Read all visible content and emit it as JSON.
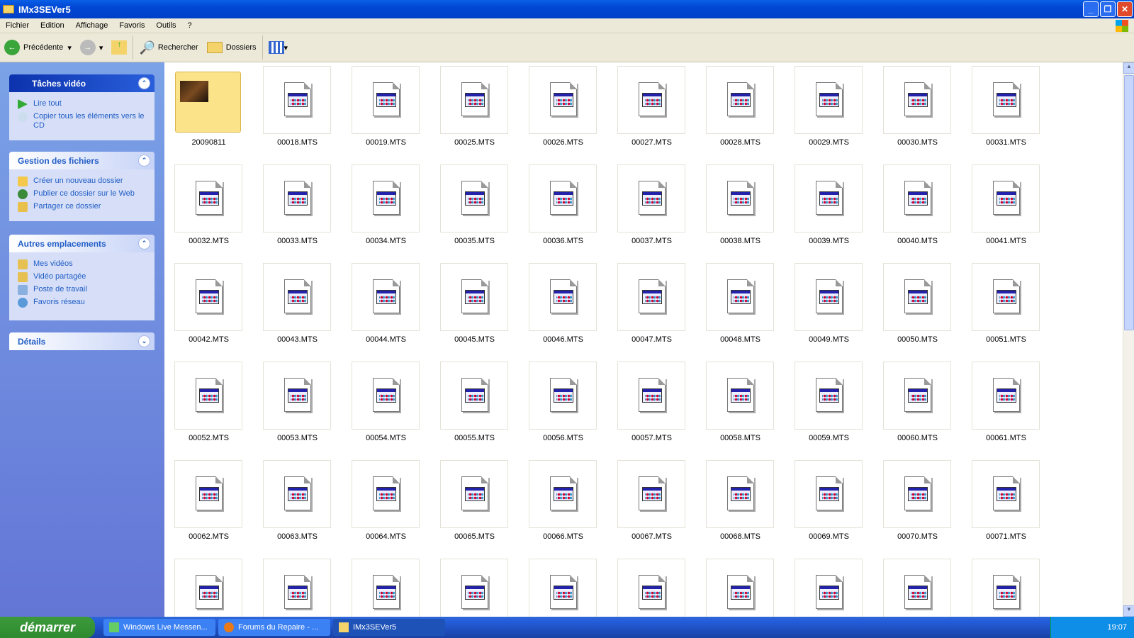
{
  "window": {
    "title": "IMx3SEVer5"
  },
  "menu": [
    "Fichier",
    "Edition",
    "Affichage",
    "Favoris",
    "Outils",
    "?"
  ],
  "toolbar": {
    "back": "Précédente",
    "search": "Rechercher",
    "folders": "Dossiers"
  },
  "sidebar": {
    "video_tasks": {
      "title": "Tâches vidéo",
      "items": [
        "Lire tout",
        "Copier tous les éléments vers le CD"
      ]
    },
    "file_tasks": {
      "title": "Gestion des fichiers",
      "items": [
        "Créer un nouveau dossier",
        "Publier ce dossier sur le Web",
        "Partager ce dossier"
      ]
    },
    "other_places": {
      "title": "Autres emplacements",
      "items": [
        "Mes vidéos",
        "Vidéo partagée",
        "Poste de travail",
        "Favoris réseau"
      ]
    },
    "details": {
      "title": "Détails"
    }
  },
  "files": [
    "20090811",
    "00018.MTS",
    "00019.MTS",
    "00025.MTS",
    "00026.MTS",
    "00027.MTS",
    "00028.MTS",
    "00029.MTS",
    "00030.MTS",
    "00031.MTS",
    "00032.MTS",
    "00033.MTS",
    "00034.MTS",
    "00035.MTS",
    "00036.MTS",
    "00037.MTS",
    "00038.MTS",
    "00039.MTS",
    "00040.MTS",
    "00041.MTS",
    "00042.MTS",
    "00043.MTS",
    "00044.MTS",
    "00045.MTS",
    "00046.MTS",
    "00047.MTS",
    "00048.MTS",
    "00049.MTS",
    "00050.MTS",
    "00051.MTS",
    "00052.MTS",
    "00053.MTS",
    "00054.MTS",
    "00055.MTS",
    "00056.MTS",
    "00057.MTS",
    "00058.MTS",
    "00059.MTS",
    "00060.MTS",
    "00061.MTS",
    "00062.MTS",
    "00063.MTS",
    "00064.MTS",
    "00065.MTS",
    "00066.MTS",
    "00067.MTS",
    "00068.MTS",
    "00069.MTS",
    "00070.MTS",
    "00071.MTS"
  ],
  "taskbar": {
    "start": "démarrer",
    "tasks": [
      "Windows Live Messen...",
      "Forums du Repaire - ...",
      "IMx3SEVer5"
    ],
    "clock": "19:07"
  }
}
